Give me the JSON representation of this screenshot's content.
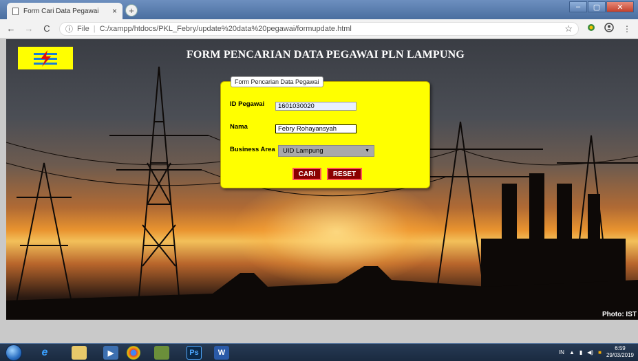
{
  "browser": {
    "tab_title": "Form Cari Data Pegawai",
    "tab_close": "×",
    "new_tab": "+",
    "back": "←",
    "forward": "→",
    "reload": "C",
    "info_icon": "ⓘ",
    "file_label": "File",
    "url": "C:/xampp/htdocs/PKL_Febry/update%20data%20pegawai/formupdate.html",
    "star": "☆",
    "menu": "⋮"
  },
  "page": {
    "title": "FORM PENCARIAN DATA PEGAWAI PLN LAMPUNG",
    "photo_credit": "Photo: IST"
  },
  "form": {
    "legend": "Form Pencarian Data Pegawai",
    "id_label": "ID Pegawai",
    "id_value": "1601030020",
    "nama_label": "Nama",
    "nama_value": "Febry Rohayansyah",
    "area_label": "Business Area",
    "area_value": "UID Lampung",
    "cari_label": "CARI",
    "reset_label": "RESET"
  },
  "taskbar": {
    "lang": "IN",
    "time": "6:59",
    "date": "29/03/2019",
    "ps_label": "Ps"
  },
  "colors": {
    "form_bg": "#ffff00",
    "button_bg": "#8b0000",
    "title_text": "#ffffff"
  }
}
